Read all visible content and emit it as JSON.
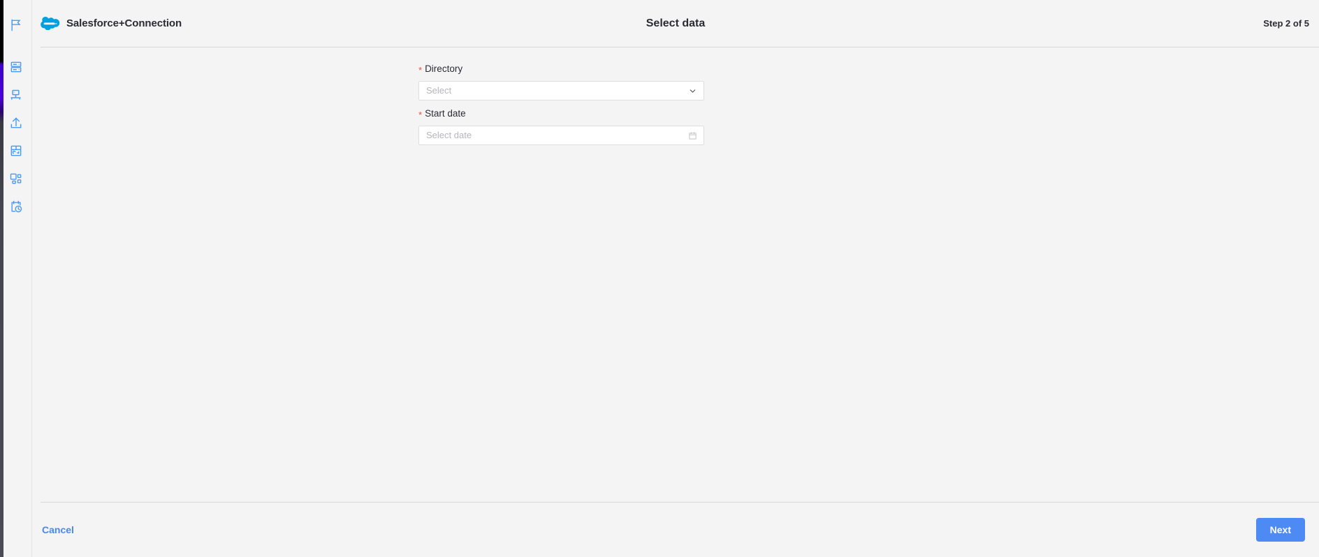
{
  "sidebar": {
    "items": [
      {
        "icon": "flag-icon",
        "name": "sidebar-item-flag"
      },
      {
        "icon": "server-icon",
        "name": "sidebar-item-server"
      },
      {
        "icon": "network-icon",
        "name": "sidebar-item-network"
      },
      {
        "icon": "upload-icon",
        "name": "sidebar-item-upload"
      },
      {
        "icon": "dashboard-icon",
        "name": "sidebar-item-dashboard"
      },
      {
        "icon": "components-icon",
        "name": "sidebar-item-components"
      },
      {
        "icon": "schedule-icon",
        "name": "sidebar-item-schedule"
      }
    ]
  },
  "header": {
    "logo_icon": "salesforce-cloud-icon",
    "brand": "Salesforce+Connection",
    "title": "Select data",
    "step": "Step 2 of 5"
  },
  "form": {
    "fields": [
      {
        "label": "Directory",
        "required_marker": "*",
        "placeholder": "Select",
        "value": "",
        "control": "select",
        "icon": "chevron-down-icon"
      },
      {
        "label": "Start date",
        "required_marker": "*",
        "placeholder": "Select date",
        "value": "",
        "control": "date",
        "icon": "calendar-icon"
      }
    ]
  },
  "footer": {
    "cancel_label": "Cancel",
    "next_label": "Next"
  },
  "colors": {
    "accent_blue": "#4d8af4",
    "link_blue": "#4a86f7",
    "salesforce_blue": "#00a1e0",
    "required_red": "#f04b4b",
    "icon_blue": "#4a9bf5",
    "page_bg": "#f4f4f5"
  }
}
